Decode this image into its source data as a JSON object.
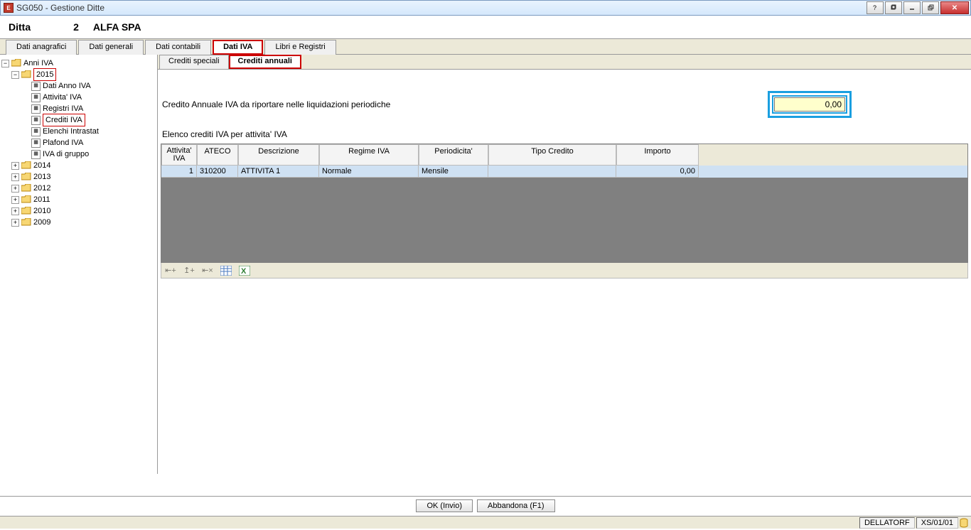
{
  "title": "SG050 - Gestione Ditte",
  "ditta": {
    "label": "Ditta",
    "num": "2",
    "name": "ALFA SPA"
  },
  "main_tabs": [
    {
      "label": "Dati anagrafici",
      "active": false,
      "highlight": false
    },
    {
      "label": "Dati generali",
      "active": false,
      "highlight": false
    },
    {
      "label": "Dati contabili",
      "active": false,
      "highlight": false
    },
    {
      "label": "Dati IVA",
      "active": true,
      "highlight": true
    },
    {
      "label": "Libri e Registri",
      "active": false,
      "highlight": false
    }
  ],
  "tree": {
    "root": "Anni IVA",
    "year_open": "2015",
    "leaves": [
      "Dati Anno IVA",
      "Attivita' IVA",
      "Registri IVA",
      "Crediti IVA",
      "Elenchi Intrastat",
      "Plafond IVA",
      "IVA di gruppo"
    ],
    "highlight_leaf": "Crediti IVA",
    "years_closed": [
      "2014",
      "2013",
      "2012",
      "2011",
      "2010",
      "2009"
    ]
  },
  "sub_tabs": [
    {
      "label": "Crediti speciali",
      "active": false,
      "highlight": false
    },
    {
      "label": "Crediti annuali",
      "active": true,
      "highlight": true
    }
  ],
  "form": {
    "credito_label": "Credito Annuale IVA da riportare nelle liquidazioni periodiche",
    "credito_value": "0,00"
  },
  "grid_title": "Elenco crediti IVA per attivita' IVA",
  "grid": {
    "headers": {
      "attivita": "Attivita' IVA",
      "ateco": "ATECO",
      "descr": "Descrizione",
      "regime": "Regime IVA",
      "period": "Periodicita'",
      "tipo": "Tipo Credito",
      "importo": "Importo"
    },
    "rows": [
      {
        "attivita": "1",
        "ateco": "310200",
        "descr": "ATTIVITA 1",
        "regime": "Normale",
        "period": "Mensile",
        "tipo": "",
        "importo": "0,00"
      }
    ]
  },
  "buttons": {
    "ok": "OK (Invio)",
    "abbandona": "Abbandona (F1)"
  },
  "status": {
    "user": "DELLATORF",
    "path": "XS/01/01"
  }
}
